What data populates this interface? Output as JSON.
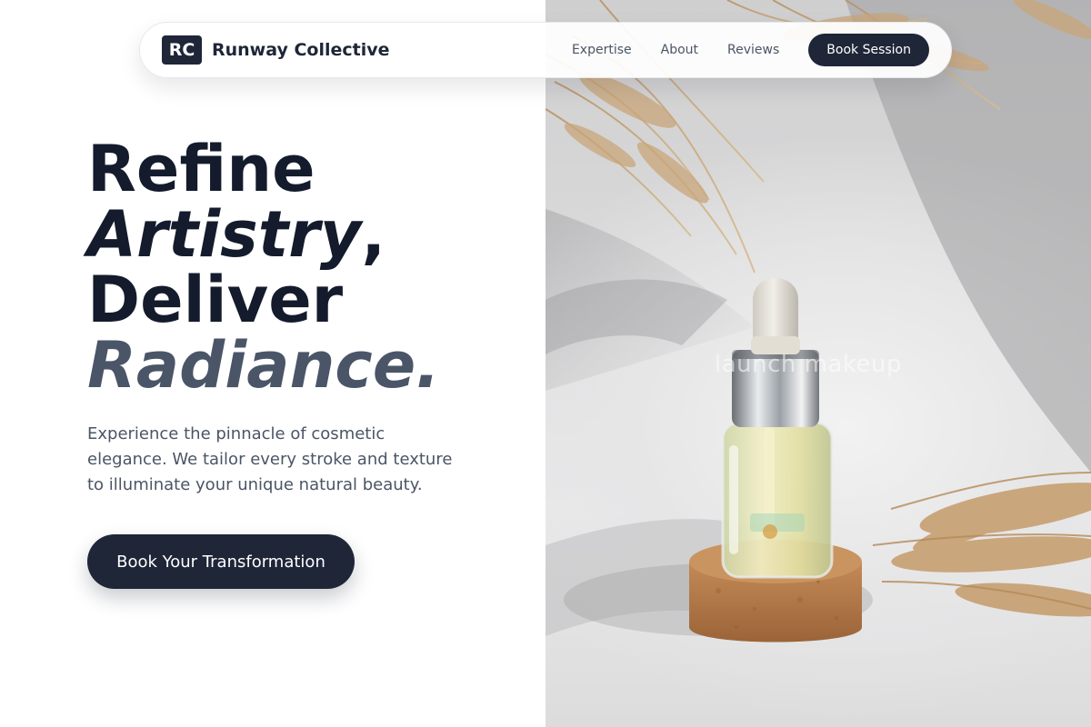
{
  "nav": {
    "brand_badge": "RC",
    "brand_name": "Runway Collective",
    "links": [
      "Expertise",
      "About",
      "Reviews"
    ],
    "cta_label": "Book Session"
  },
  "hero": {
    "line1": "Refine",
    "line2_strong": "Artistry",
    "line2_comma": ",",
    "line3": "Deliver",
    "line4_accent": "Radiance.",
    "subtitle": "Experience the pinnacle of cosmetic elegance. We tailor every stroke and texture to illuminate your unique natural beauty.",
    "cta_label": "Book Your Transformation",
    "image_caption": "launch makeup"
  },
  "colors": {
    "navy": "#1e2638",
    "headline": "#141b2c",
    "accent_slate": "#4a5568",
    "body_text": "#4b5565"
  }
}
